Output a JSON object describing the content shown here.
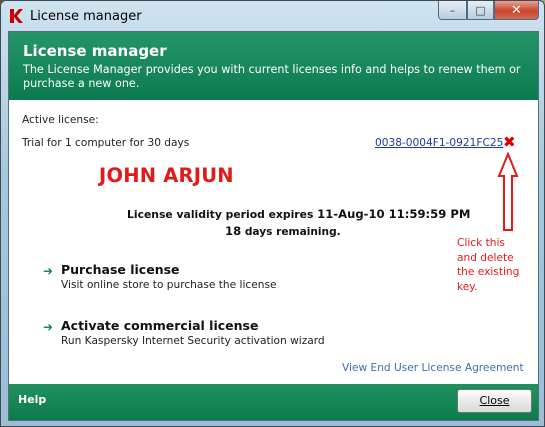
{
  "window": {
    "title": "License manager",
    "controls": {
      "minimize": "–",
      "maximize": "□",
      "close": "✕"
    }
  },
  "header": {
    "title": "License manager",
    "description": "The License Manager provides you with current licenses info and helps to renew them or purchase a new one."
  },
  "license": {
    "active_label": "Active license:",
    "type": "Trial for 1 computer for 30 days",
    "key": "0038-0004F1-0921FC25",
    "delete_icon": "✖",
    "validity_text": "License validity period expires",
    "expiry": "11-Aug-10 11:59:59 PM",
    "days": "18",
    "days_suffix": "days remaining."
  },
  "annotations": {
    "name": "JOHN ARJUN",
    "note_lines": [
      "Click this",
      "and delete",
      "the existing",
      "key."
    ],
    "color": "#e31a1a"
  },
  "actions": [
    {
      "title": "Purchase license",
      "description": "Visit online store to purchase the license",
      "icon": "arrow-right-icon"
    },
    {
      "title": "Activate commercial license",
      "description": "Run Kaspersky Internet Security activation wizard",
      "icon": "arrow-right-icon"
    }
  ],
  "eula_link": "View End User License Agreement",
  "footer": {
    "help": "Help",
    "close": "Close"
  },
  "colors": {
    "header_green": "#1b8a5c",
    "link_blue": "#1f3a9e",
    "accent_red": "#d40000"
  }
}
